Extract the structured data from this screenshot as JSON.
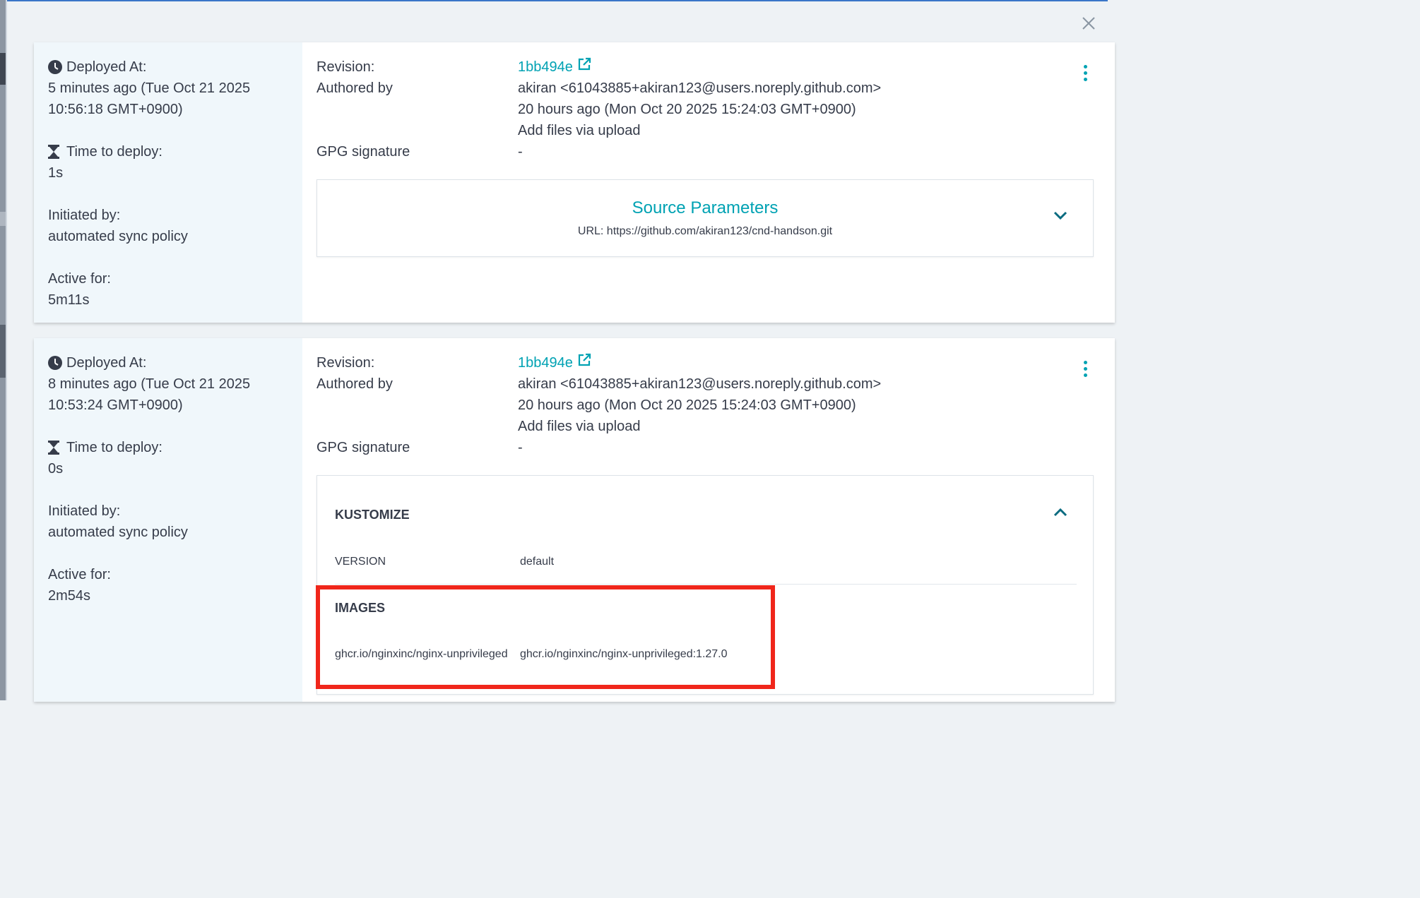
{
  "modal": {
    "close_icon": "close-icon"
  },
  "colors": {
    "accent": "#00a2b3",
    "highlight": "#f0261b",
    "sidebar_bg": "#f0f7fb"
  },
  "deployments": [
    {
      "deployed_at_label": "Deployed At:",
      "deployed_at_value": "5 minutes ago (Tue Oct 21 2025 10:56:18 GMT+0900)",
      "time_to_deploy_label": "Time to deploy:",
      "time_to_deploy_value": "1s",
      "initiated_by_label": "Initiated by:",
      "initiated_by_value": "automated sync policy",
      "active_for_label": "Active for:",
      "active_for_value": "5m11s",
      "revision_label": "Revision:",
      "revision_hash": "1bb494e",
      "authored_by_label": "Authored by",
      "author": "akiran <61043885+akiran123@users.noreply.github.com>",
      "authored_time": "20 hours ago (Mon Oct 20 2025 15:24:03 GMT+0900)",
      "commit_message": "Add files via upload",
      "gpg_label": "GPG signature",
      "gpg_value": "-",
      "source_parameters": {
        "title": "Source Parameters",
        "url": "URL: https://github.com/akiran123/cnd-handson.git"
      }
    },
    {
      "deployed_at_label": "Deployed At:",
      "deployed_at_value": "8 minutes ago (Tue Oct 21 2025 10:53:24 GMT+0900)",
      "time_to_deploy_label": "Time to deploy:",
      "time_to_deploy_value": "0s",
      "initiated_by_label": "Initiated by:",
      "initiated_by_value": "automated sync policy",
      "active_for_label": "Active for:",
      "active_for_value": "2m54s",
      "revision_label": "Revision:",
      "revision_hash": "1bb494e",
      "authored_by_label": "Authored by",
      "author": "akiran <61043885+akiran123@users.noreply.github.com>",
      "authored_time": "20 hours ago (Mon Oct 20 2025 15:24:03 GMT+0900)",
      "commit_message": "Add files via upload",
      "gpg_label": "GPG signature",
      "gpg_value": "-",
      "kustomize": {
        "title": "KUSTOMIZE",
        "version_label": "VERSION",
        "version_value": "default",
        "images_label": "IMAGES",
        "image_name": "ghcr.io/nginxinc/nginx-unprivileged",
        "image_value": "ghcr.io/nginxinc/nginx-unprivileged:1.27.0"
      }
    }
  ]
}
